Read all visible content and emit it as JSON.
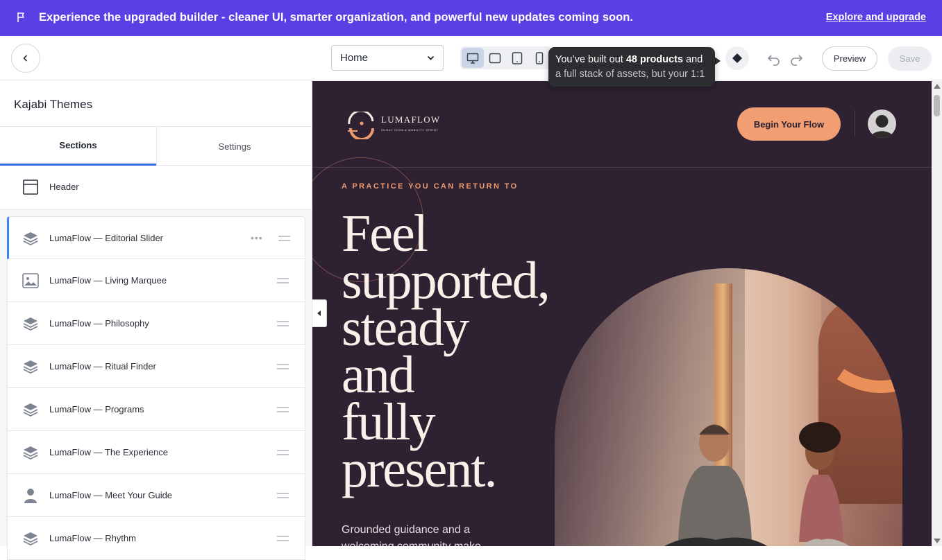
{
  "banner": {
    "message": "Experience the upgraded builder - cleaner UI, smarter organization, and powerful new updates coming soon.",
    "link": "Explore and upgrade",
    "icon": "flag-icon"
  },
  "toolbar": {
    "page_select": "Home",
    "devices": [
      "desktop",
      "tablet-landscape",
      "tablet-portrait",
      "mobile"
    ],
    "tooltip": {
      "pre": "You’ve built out ",
      "bold": "48 products",
      "post": " and",
      "line2": "a full stack of assets, but your 1:1"
    },
    "preview_label": "Preview",
    "save_label": "Save"
  },
  "sidebar": {
    "title": "Kajabi Themes",
    "tabs": [
      "Sections",
      "Settings"
    ],
    "header_item": "Header",
    "sections": [
      {
        "label": "LumaFlow — Editorial Slider",
        "icon": "layers-icon"
      },
      {
        "label": "LumaFlow — Living Marquee",
        "icon": "image-icon"
      },
      {
        "label": "LumaFlow — Philosophy",
        "icon": "layers-icon"
      },
      {
        "label": "LumaFlow — Ritual Finder",
        "icon": "layers-icon"
      },
      {
        "label": "LumaFlow — Programs",
        "icon": "layers-icon"
      },
      {
        "label": "LumaFlow — The Experience",
        "icon": "layers-icon"
      },
      {
        "label": "LumaFlow — Meet Your Guide",
        "icon": "person-icon"
      },
      {
        "label": "LumaFlow — Rhythm",
        "icon": "layers-icon"
      }
    ]
  },
  "site": {
    "logo_name": "LUMAFLOW",
    "logo_tag": "30 DAY YOGA & MOBILITY SPRINT",
    "cta": "Begin Your Flow",
    "eyebrow": "A PRACTICE YOU CAN RETURN TO",
    "hero_lines": [
      "Feel",
      "supported,",
      "steady",
      "and",
      "fully",
      "present."
    ],
    "hero_sub": "Grounded guidance and a",
    "hero_sub2": "welcoming community make"
  },
  "colors": {
    "banner": "#5b3fe4",
    "canvas_bg": "#2d2132",
    "accent": "#f09e72",
    "active_tab": "#2f6fe0"
  }
}
